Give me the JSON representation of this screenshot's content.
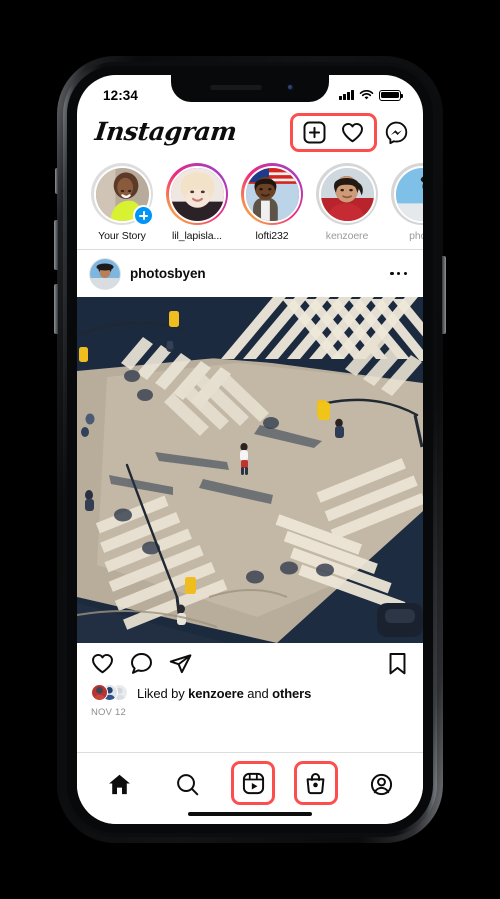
{
  "status_bar": {
    "time": "12:34",
    "signal_icon": "cellular-signal-icon",
    "wifi_icon": "wifi-icon",
    "battery_icon": "battery-full-icon"
  },
  "header": {
    "wordmark": "Instagram",
    "new_post_icon": "plus-square-icon",
    "activity_icon": "heart-icon",
    "messenger_icon": "messenger-icon",
    "highlight_color": "#fd4e4e"
  },
  "stories": [
    {
      "name": "Your Story",
      "ring": "none",
      "has_plus_badge": true,
      "viewed": false
    },
    {
      "name": "lil_lapisla...",
      "ring": "gradient",
      "has_plus_badge": false,
      "viewed": false
    },
    {
      "name": "lofti232",
      "ring": "gradient",
      "has_plus_badge": false,
      "viewed": false
    },
    {
      "name": "kenzoere",
      "ring": "gray",
      "has_plus_badge": false,
      "viewed": true
    },
    {
      "name": "photo",
      "ring": "gray",
      "has_plus_badge": false,
      "viewed": true
    }
  ],
  "post": {
    "username": "photosbyen",
    "more_options_icon": "ellipsis-icon",
    "image_alt": "aerial view of a city crosswalk intersection with pedestrians",
    "like_icon": "heart-icon",
    "comment_icon": "comment-bubble-icon",
    "share_icon": "share-paperplane-icon",
    "save_icon": "bookmark-icon",
    "likes_prefix": "Liked by ",
    "likes_user": "kenzoere",
    "likes_middle": " and ",
    "likes_suffix": "others",
    "date": "NOV 12"
  },
  "tabbar": {
    "items": [
      {
        "name": "home",
        "icon": "home-icon",
        "highlighted": false,
        "active": true
      },
      {
        "name": "search",
        "icon": "search-icon",
        "highlighted": false,
        "active": false
      },
      {
        "name": "reels",
        "icon": "reels-icon",
        "highlighted": true,
        "active": false
      },
      {
        "name": "shop",
        "icon": "shop-bag-icon",
        "highlighted": true,
        "active": false
      },
      {
        "name": "profile",
        "icon": "profile-icon",
        "highlighted": false,
        "active": false
      }
    ]
  },
  "device": {
    "home_indicator": "home-indicator-bar",
    "notch": "device-notch"
  }
}
